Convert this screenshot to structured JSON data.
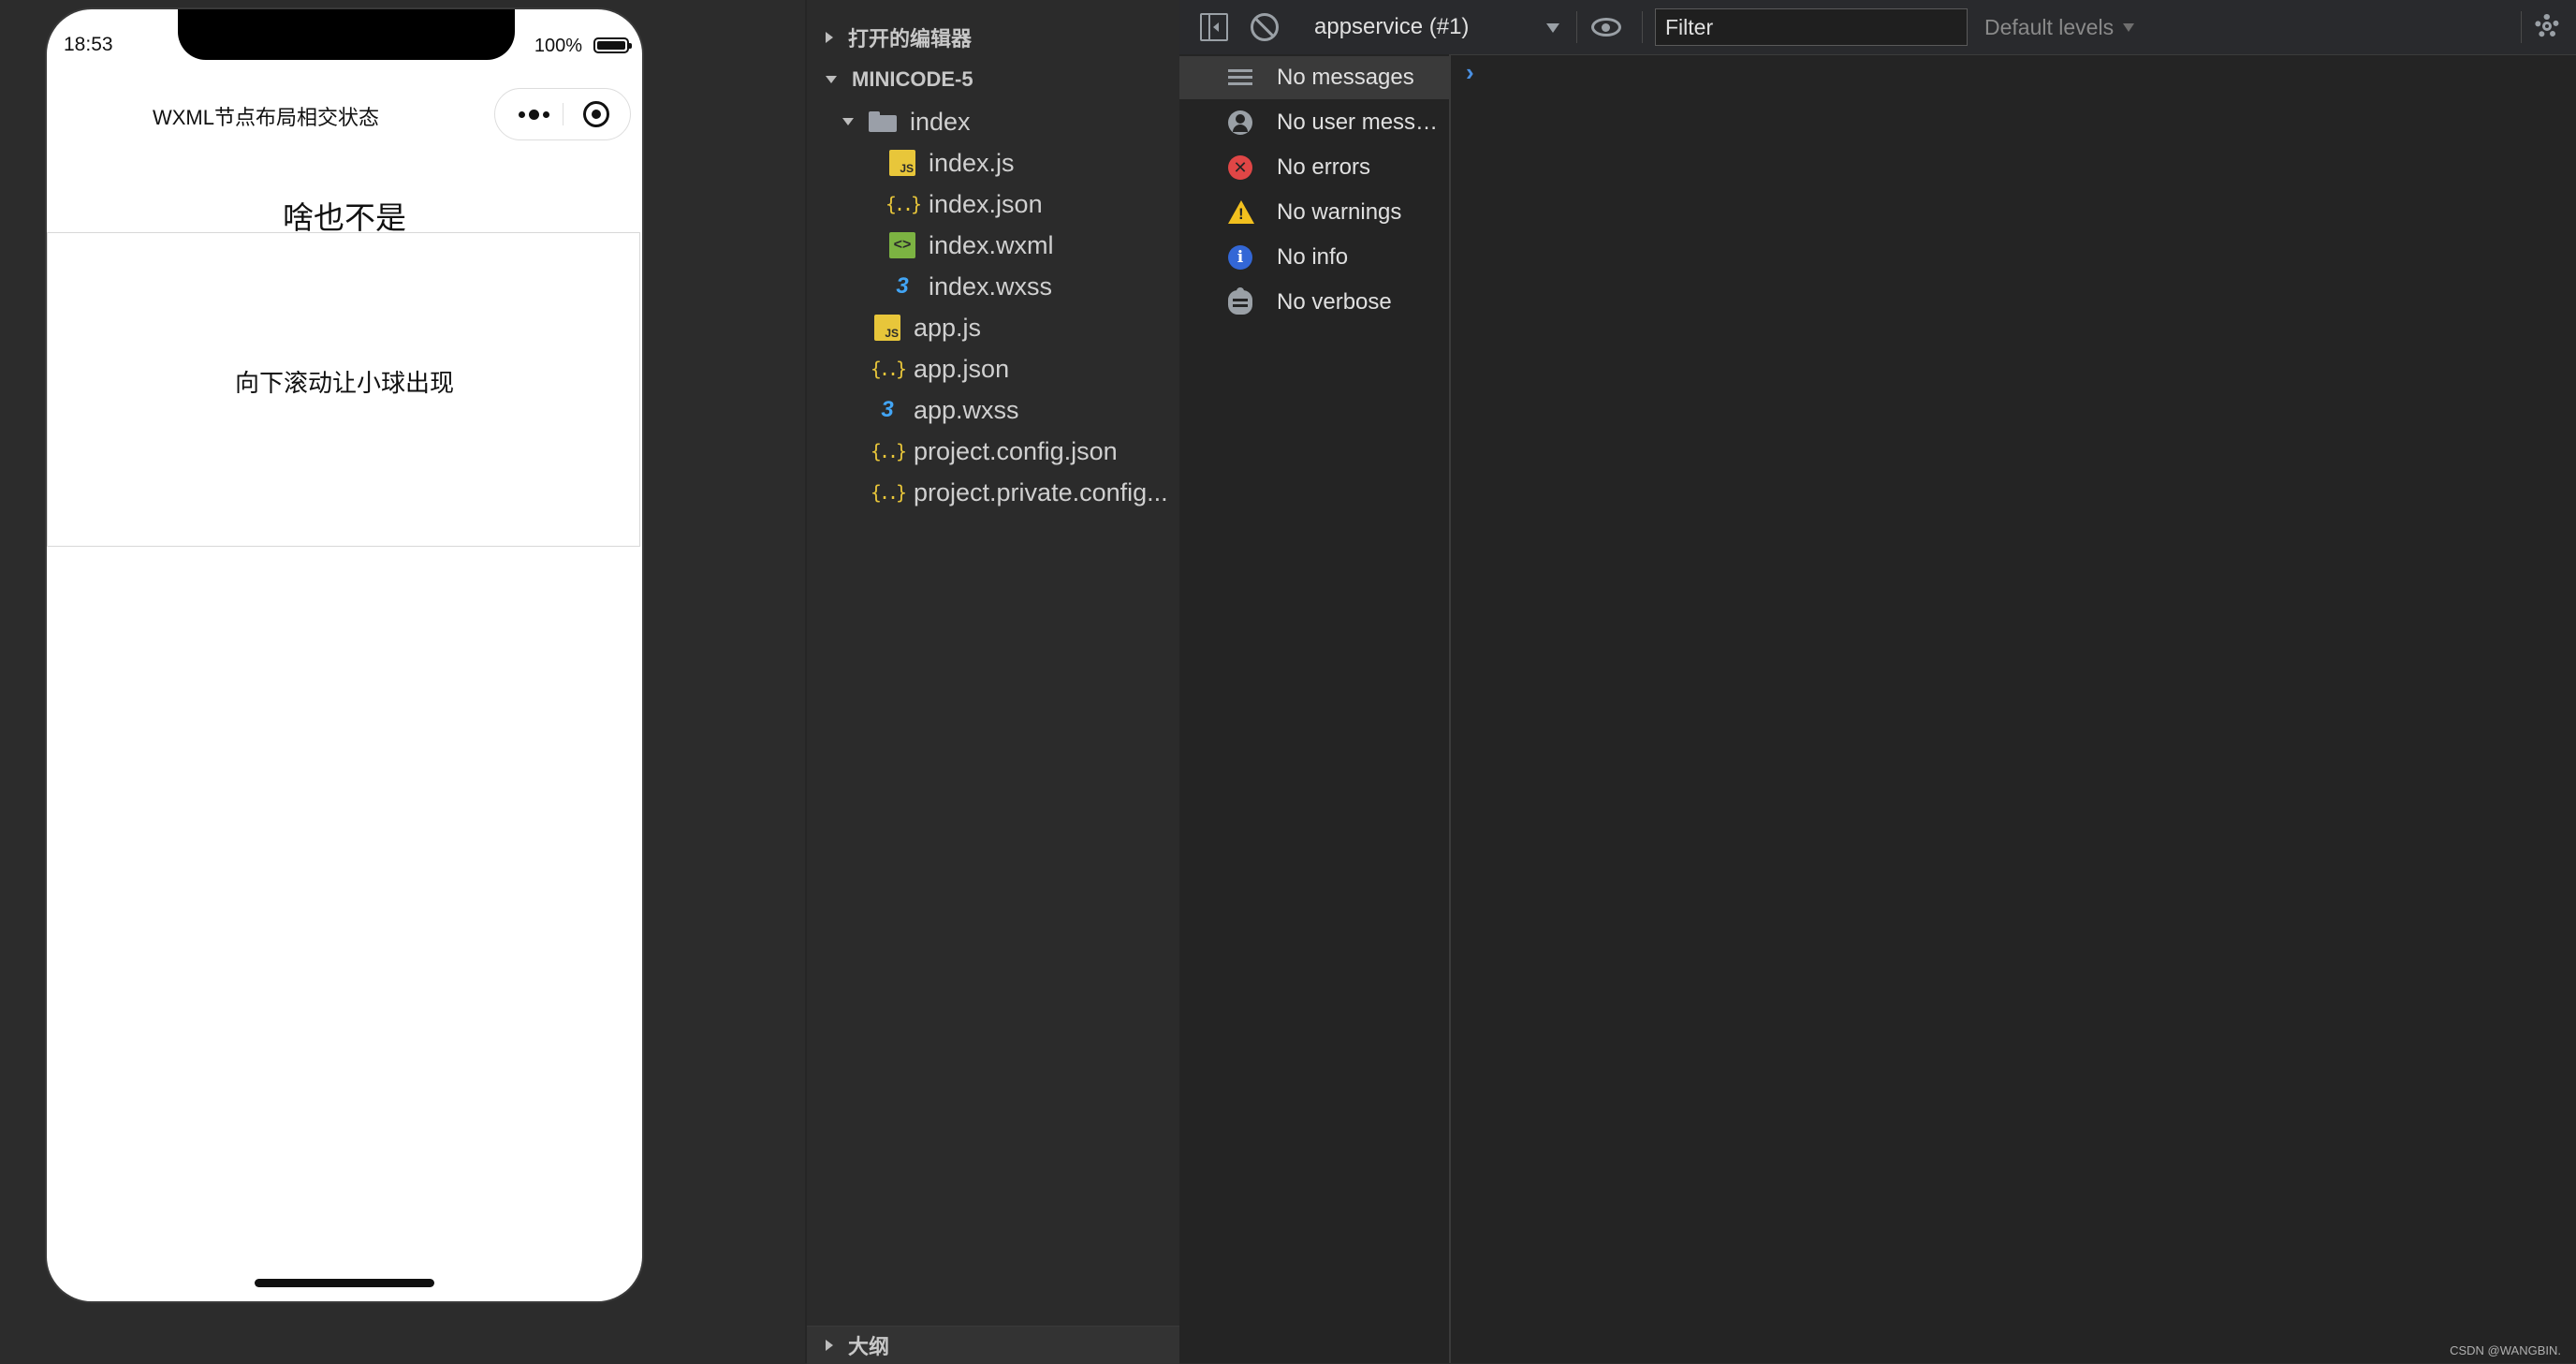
{
  "simulator": {
    "status": {
      "time": "18:53",
      "battery": "100%"
    },
    "nav_title": "WXML节点布局相交状态",
    "page_heading": "啥也不是",
    "scroll_hint": "向下滚动让小球出现"
  },
  "explorer": {
    "open_editors": "打开的编辑器",
    "project": "MINICODE-5",
    "tree": [
      {
        "label": "index",
        "type": "folder"
      },
      {
        "label": "index.js",
        "type": "js"
      },
      {
        "label": "index.json",
        "type": "json"
      },
      {
        "label": "index.wxml",
        "type": "wxml"
      },
      {
        "label": "index.wxss",
        "type": "wxss"
      },
      {
        "label": "app.js",
        "type": "js"
      },
      {
        "label": "app.json",
        "type": "json"
      },
      {
        "label": "app.wxss",
        "type": "wxss"
      },
      {
        "label": "project.config.json",
        "type": "json"
      },
      {
        "label": "project.private.config...",
        "type": "json"
      }
    ],
    "icons": {
      "js": "JS",
      "json": "{..}",
      "wxml": "<>",
      "wxss": "3"
    },
    "outline": "大纲"
  },
  "console": {
    "context": "appservice (#1)",
    "filter_placeholder": "Filter",
    "levels": "Default levels",
    "sidebar": [
      {
        "label": "No messages",
        "icon": "list-icon"
      },
      {
        "label": "No user mess…",
        "icon": "user-icon"
      },
      {
        "label": "No errors",
        "icon": "error-icon"
      },
      {
        "label": "No warnings",
        "icon": "warning-icon"
      },
      {
        "label": "No info",
        "icon": "info-icon"
      },
      {
        "label": "No verbose",
        "icon": "verbose-icon"
      }
    ],
    "prompt": "›",
    "icon_glyphs": {
      "error": "✕",
      "warning": "!",
      "info": "i"
    }
  },
  "colors": {
    "accent": "#4a90e2",
    "error": "#e04646",
    "warning": "#f2c01e",
    "info": "#3367d6",
    "js": "#e8c63a",
    "wxml": "#7cb342",
    "wxss": "#42a5f5"
  },
  "watermark": "CSDN @WANGBIN."
}
